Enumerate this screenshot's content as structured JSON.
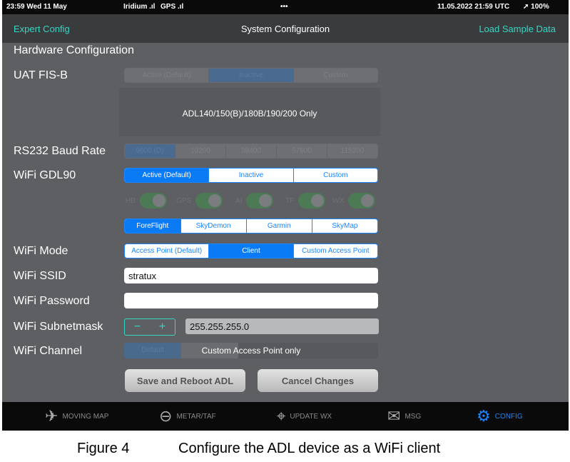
{
  "status": {
    "time": "23:59  Wed 11 May",
    "iridium": "Iridium .ıl",
    "gps": "GPS .ıl",
    "dots": "•••",
    "utc": "11.05.2022  21:59 UTC",
    "battery": "➚ 100%"
  },
  "nav": {
    "left": "Expert Config",
    "title": "System Configuration",
    "right": "Load Sample Data"
  },
  "section": "Hardware Configuration",
  "uat": {
    "label": "UAT FIS-B",
    "options": [
      "Active (Default)",
      "Inactive",
      "Custom"
    ],
    "note": "ADL140/150(B)/180B/190/200 Only"
  },
  "baud": {
    "label": "RS232 Baud Rate",
    "options": [
      "9600 (D)",
      "19200",
      "38400",
      "57600",
      "115200"
    ]
  },
  "gdl90": {
    "label": "WiFi GDL90",
    "options": [
      "Active (Default)",
      "Inactive",
      "Custom"
    ]
  },
  "toggles": [
    "HB",
    "GPS",
    "AI",
    "TF",
    "WX"
  ],
  "apps": [
    "ForeFlight",
    "SkyDemon",
    "Garmin",
    "SkyMap"
  ],
  "mode": {
    "label": "WiFi Mode",
    "options": [
      "Access Point (Default)",
      "Client",
      "Custom Access Point"
    ]
  },
  "ssid": {
    "label": "WiFi SSID",
    "value": "stratux"
  },
  "password": {
    "label": "WiFi Password",
    "value": ""
  },
  "subnet": {
    "label": "WiFi Subnetmask",
    "minus": "−",
    "plus": "+",
    "value": "255.255.255.0"
  },
  "channel": {
    "label": "WiFi Channel",
    "option": "Default",
    "note": "Custom Access Point only"
  },
  "buttons": {
    "save": "Save and Reboot ADL",
    "cancel": "Cancel Changes"
  },
  "tabs": [
    {
      "label": "MOVING MAP",
      "icon": "✈"
    },
    {
      "label": "METAR/TAF",
      "icon": "⊖"
    },
    {
      "label": "UPDATE WX",
      "icon": "📡"
    },
    {
      "label": "MSG",
      "icon": "✉"
    },
    {
      "label": "CONFIG",
      "icon": "⚙"
    }
  ],
  "caption": {
    "figure": "Figure 4",
    "text": "Configure the ADL device as a WiFi client"
  }
}
